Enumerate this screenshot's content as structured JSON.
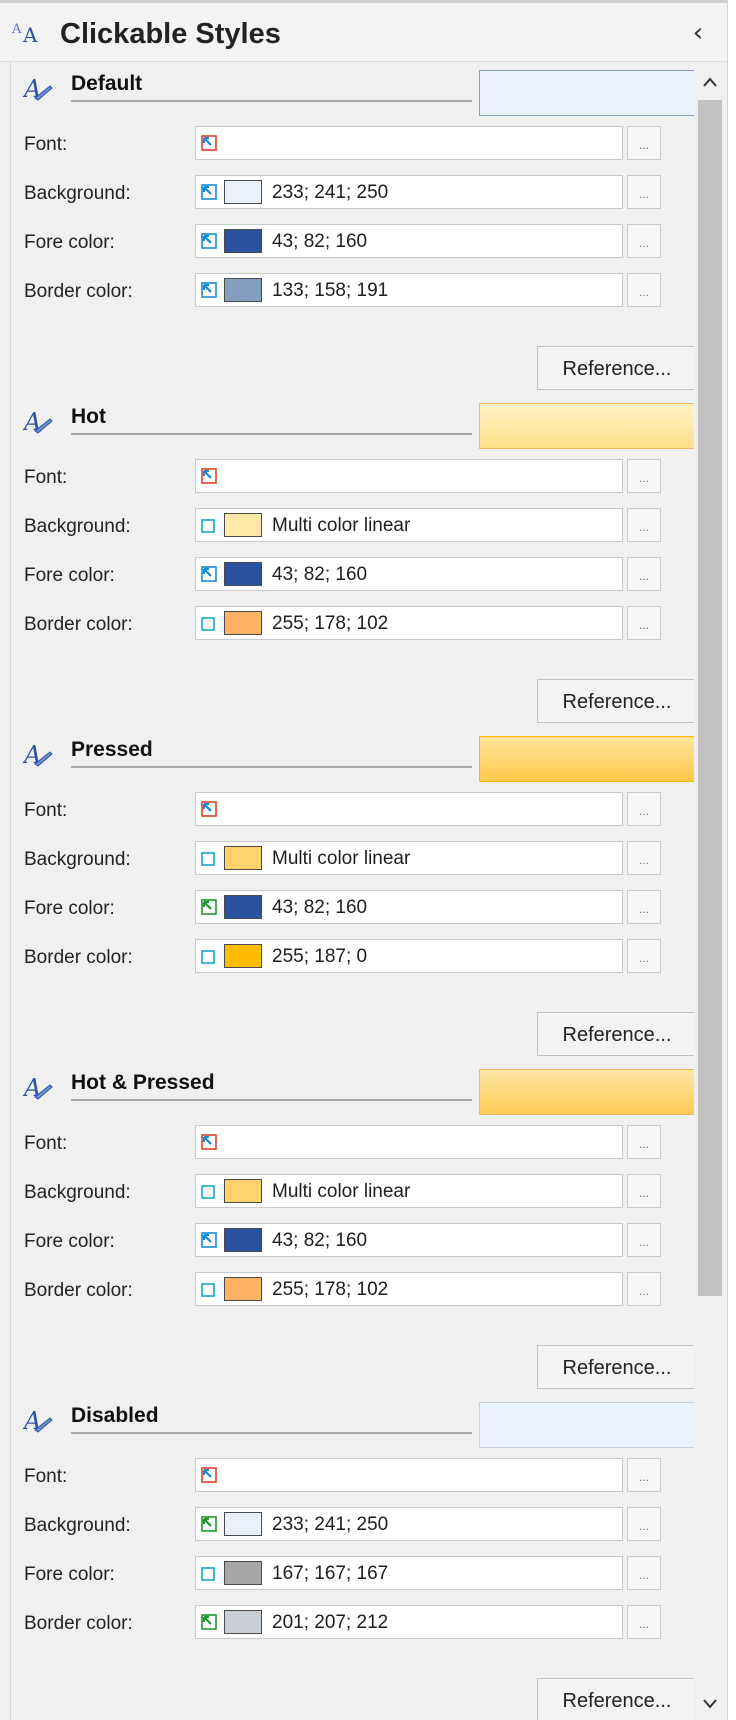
{
  "panel": {
    "title": "Clickable Styles",
    "title_icon": "font-style-icon",
    "collapse_glyph": "‹"
  },
  "scrollbar": {
    "up_glyph": "^",
    "down_glyph": "v"
  },
  "labels": {
    "font": "Font:",
    "background": "Background:",
    "fore_color": "Fore color:",
    "border_color": "Border color:",
    "reference": "Reference...",
    "dropdown": "▾",
    "ellipsis": "..."
  },
  "colors": {
    "inherit_blue": "#1a8ad4",
    "inherit_green": "#1e9a2c",
    "override_red": "#e0402a",
    "unset_cyan": "#19a7c9"
  },
  "sections": [
    {
      "title": "Default",
      "preview": {
        "fill": "#e9f1fa",
        "border": "#859ebf"
      },
      "font": {
        "icon": "inherit-red"
      },
      "background": {
        "icon": "inherit-blue",
        "swatch": "#e9f1fa",
        "text": "233; 241; 250"
      },
      "fore_color": {
        "icon": "inherit-blue",
        "swatch": "#2b52a0",
        "text": "43; 82; 160"
      },
      "border_color": {
        "icon": "inherit-blue",
        "swatch": "#859ebf",
        "text": "133; 158; 191"
      },
      "reference": "Reference..."
    },
    {
      "title": "Hot",
      "preview": {
        "fill": "#ffe9a8",
        "border": "#ffb266",
        "gradient": [
          "#fff2c4",
          "#ffe08a"
        ]
      },
      "font": {
        "icon": "inherit-red"
      },
      "background": {
        "icon": "unset",
        "swatch": "#ffe9a8",
        "text": "Multi color linear"
      },
      "fore_color": {
        "icon": "inherit-blue",
        "swatch": "#2b52a0",
        "text": "43; 82; 160"
      },
      "border_color": {
        "icon": "unset",
        "swatch": "#ffb266",
        "text": "255; 178; 102"
      },
      "reference": "Reference..."
    },
    {
      "title": "Pressed",
      "preview": {
        "fill": "#ffd36b",
        "border": "#ffbb00",
        "gradient": [
          "#ffe49a",
          "#ffc94a"
        ]
      },
      "font": {
        "icon": "inherit-red"
      },
      "background": {
        "icon": "unset",
        "swatch": "#ffd36b",
        "text": "Multi color linear"
      },
      "fore_color": {
        "icon": "inherit-green",
        "swatch": "#2b52a0",
        "text": "43; 82; 160"
      },
      "border_color": {
        "icon": "unset",
        "swatch": "#ffbb00",
        "text": "255; 187; 0"
      },
      "reference": "Reference..."
    },
    {
      "title": "Hot & Pressed",
      "preview": {
        "fill": "#ffd36b",
        "border": "#ffb266",
        "gradient": [
          "#ffe6a4",
          "#ffcb55"
        ]
      },
      "font": {
        "icon": "inherit-red"
      },
      "background": {
        "icon": "unset",
        "swatch": "#ffd36b",
        "text": "Multi color linear"
      },
      "fore_color": {
        "icon": "inherit-blue",
        "swatch": "#2b52a0",
        "text": "43; 82; 160"
      },
      "border_color": {
        "icon": "unset",
        "swatch": "#ffb266",
        "text": "255; 178; 102"
      },
      "reference": "Reference..."
    },
    {
      "title": "Disabled",
      "preview": {
        "fill": "#e9f1fa",
        "border": "#c9cfd4"
      },
      "font": {
        "icon": "inherit-red"
      },
      "background": {
        "icon": "inherit-green",
        "swatch": "#e9f1fa",
        "text": "233; 241; 250"
      },
      "fore_color": {
        "icon": "unset",
        "swatch": "#a7a7a7",
        "text": "167; 167; 167"
      },
      "border_color": {
        "icon": "inherit-green",
        "swatch": "#c9cfd4",
        "text": "201; 207; 212"
      },
      "reference": "Reference..."
    }
  ]
}
